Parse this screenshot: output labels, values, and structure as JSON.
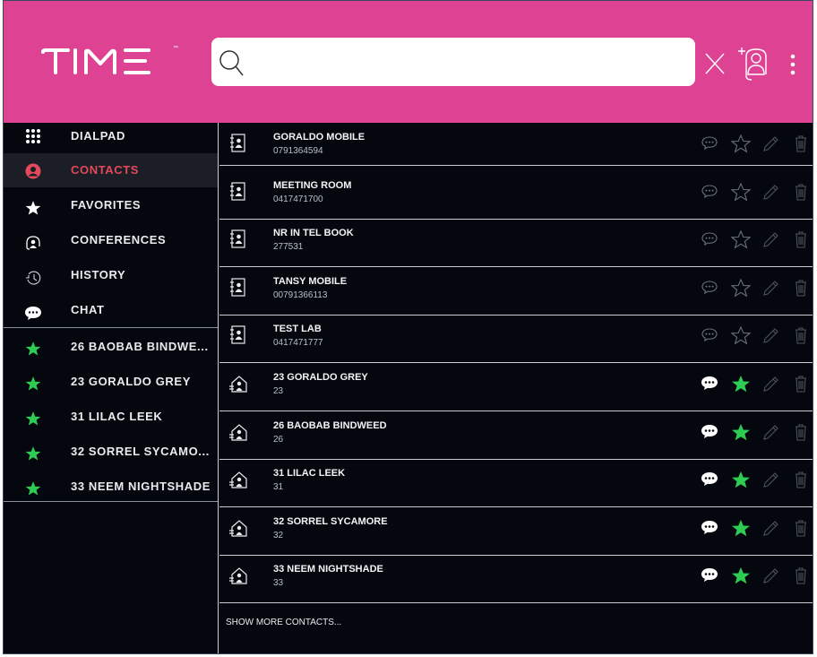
{
  "header": {
    "logo_text": "TIME",
    "logo_tm": "™",
    "search": {
      "placeholder": "",
      "value": ""
    },
    "brand_color": "#de4292"
  },
  "sidebar": {
    "nav": [
      {
        "label": "DIALPAD",
        "icon": "dialpad-grid-icon"
      },
      {
        "label": "CONTACTS",
        "icon": "contact-person-icon",
        "active": true
      },
      {
        "label": "FAVORITES",
        "icon": "star-icon"
      },
      {
        "label": "CONFERENCES",
        "icon": "conference-headset-icon"
      },
      {
        "label": "HISTORY",
        "icon": "history-clock-icon"
      },
      {
        "label": "CHAT",
        "icon": "chat-bubble-icon"
      }
    ],
    "favorites": [
      {
        "label": "26 BAOBAB BINDWE..."
      },
      {
        "label": "23 GORALDO GREY"
      },
      {
        "label": "31 LILAC LEEK"
      },
      {
        "label": "32 SORREL SYCAMO..."
      },
      {
        "label": "33 NEEM NIGHTSHADE"
      }
    ],
    "active_color": "#e2495c",
    "favorite_color": "#2ecc52"
  },
  "contacts": [
    {
      "name": "GORALDO MOBILE",
      "number": "0791364594",
      "type": "phonebook",
      "favorite": false
    },
    {
      "name": "MEETING ROOM",
      "number": "0417471700",
      "type": "phonebook",
      "favorite": false
    },
    {
      "name": "NR IN TEL BOOK",
      "number": "277531",
      "type": "phonebook",
      "favorite": false
    },
    {
      "name": "TANSY MOBILE",
      "number": "00791366113",
      "type": "phonebook",
      "favorite": false
    },
    {
      "name": "TEST LAB",
      "number": "0417471777",
      "type": "phonebook",
      "favorite": false
    },
    {
      "name": "23 GORALDO GREY",
      "number": "23",
      "type": "internal",
      "favorite": true
    },
    {
      "name": "26 BAOBAB BINDWEED",
      "number": "26",
      "type": "internal",
      "favorite": true
    },
    {
      "name": "31 LILAC LEEK",
      "number": "31",
      "type": "internal",
      "favorite": true
    },
    {
      "name": "32 SORREL SYCAMORE",
      "number": "32",
      "type": "internal",
      "favorite": true
    },
    {
      "name": "33 NEEM NIGHTSHADE",
      "number": "33",
      "type": "internal",
      "favorite": true
    }
  ],
  "show_more_label": "SHOW MORE CONTACTS..."
}
